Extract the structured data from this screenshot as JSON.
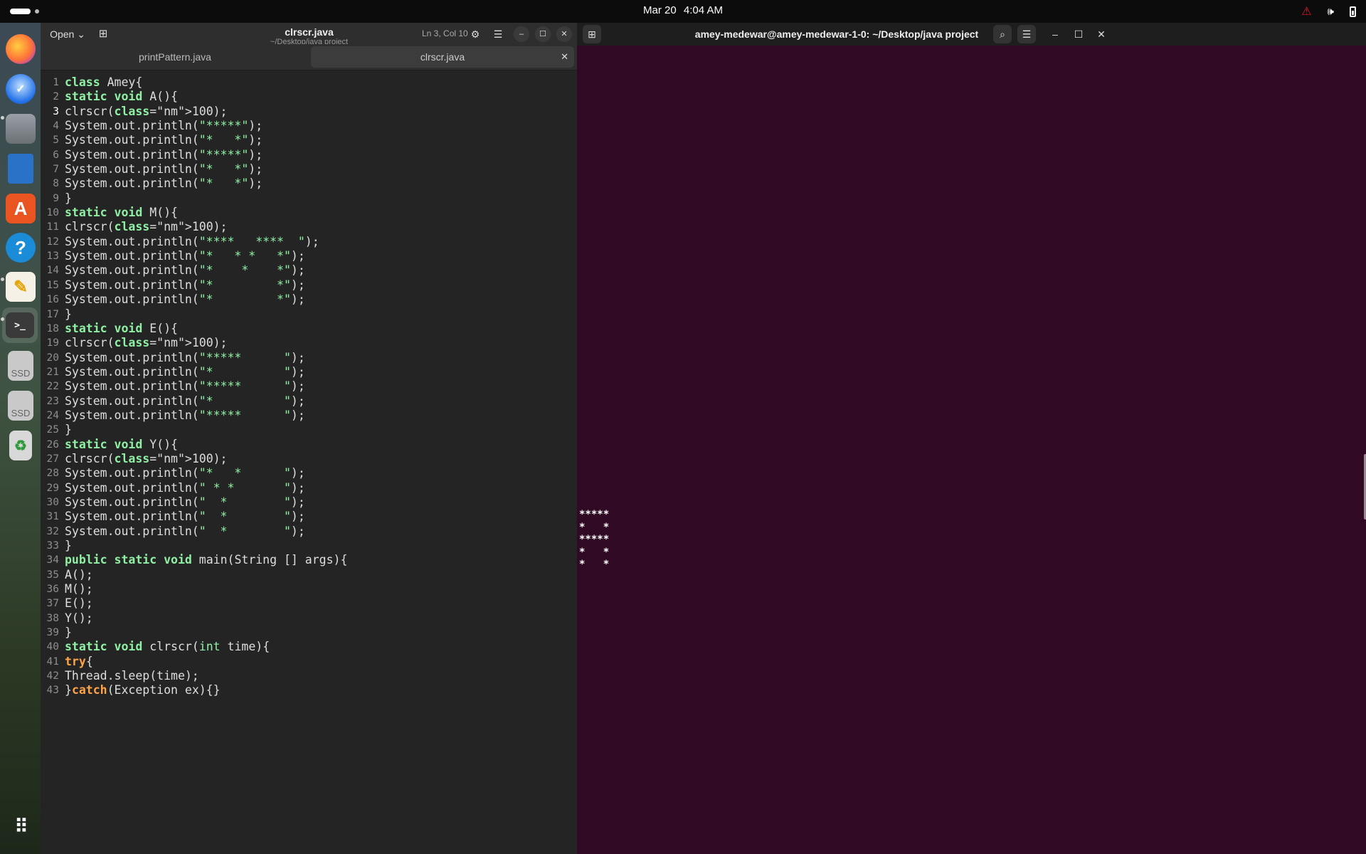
{
  "topbar": {
    "date": "Mar 20",
    "time": "4:04 AM",
    "icons": [
      "warning-icon",
      "volume-icon",
      "battery-icon"
    ]
  },
  "dock": {
    "apps": [
      {
        "name": "firefox",
        "icon": "firefox-icon",
        "running": false
      },
      {
        "name": "thunderbird",
        "icon": "thunderbird-icon",
        "running": false
      },
      {
        "name": "files",
        "icon": "files-icon",
        "running": true
      },
      {
        "name": "libreoffice-writer",
        "icon": "writer-icon",
        "running": false
      },
      {
        "name": "app-center",
        "icon": "app-center-icon",
        "running": false
      },
      {
        "name": "help",
        "icon": "help-icon",
        "running": false
      },
      {
        "name": "text-editor",
        "icon": "text-editor-icon",
        "running": true
      },
      {
        "name": "terminal",
        "icon": "terminal-icon",
        "running": true,
        "active": true
      },
      {
        "name": "ssd-1",
        "icon": "ssd-drive-icon",
        "label": "SSD"
      },
      {
        "name": "ssd-2",
        "icon": "ssd-drive-icon",
        "label": "SSD"
      },
      {
        "name": "trash",
        "icon": "trash-icon"
      },
      {
        "name": "show-apps",
        "icon": "app-grid-icon"
      }
    ]
  },
  "editor": {
    "open_label": "Open",
    "title": "clrscr.java",
    "subtitle": "~/Desktop/java project",
    "cursor_position": "Ln 3, Col 10",
    "tabs": [
      {
        "label": "printPattern.java",
        "active": false
      },
      {
        "label": "clrscr.java",
        "active": true
      }
    ],
    "current_line": 3,
    "lines": [
      "class Amey{",
      "static void A(){",
      "clrscr(100);",
      "System.out.println(\"*****\");",
      "System.out.println(\"*   *\");",
      "System.out.println(\"*****\");",
      "System.out.println(\"*   *\");",
      "System.out.println(\"*   *\");",
      "}",
      "static void M(){",
      "clrscr(100);",
      "System.out.println(\"****   ****  \");",
      "System.out.println(\"*   * *   *\");",
      "System.out.println(\"*    *    *\");",
      "System.out.println(\"*         *\");",
      "System.out.println(\"*         *\");",
      "}",
      "static void E(){",
      "clrscr(100);",
      "System.out.println(\"*****      \");",
      "System.out.println(\"*          \");",
      "System.out.println(\"*****      \");",
      "System.out.println(\"*          \");",
      "System.out.println(\"*****      \");",
      "}",
      "static void Y(){",
      "clrscr(100);",
      "System.out.println(\"*   *      \");",
      "System.out.println(\" * *       \");",
      "System.out.println(\"  *        \");",
      "System.out.println(\"  *        \");",
      "System.out.println(\"  *        \");",
      "}",
      "public static void main(String [] args){",
      "A();",
      "M();",
      "E();",
      "Y();",
      "}",
      "static void clrscr(int time){",
      "try{",
      "Thread.sleep(time);",
      "}catch(Exception ex){}"
    ]
  },
  "terminal": {
    "title": "amey-medewar@amey-medewar-1-0: ~/Desktop/java project",
    "output": "*****\n*   *\n*****\n*   *\n*   *"
  }
}
